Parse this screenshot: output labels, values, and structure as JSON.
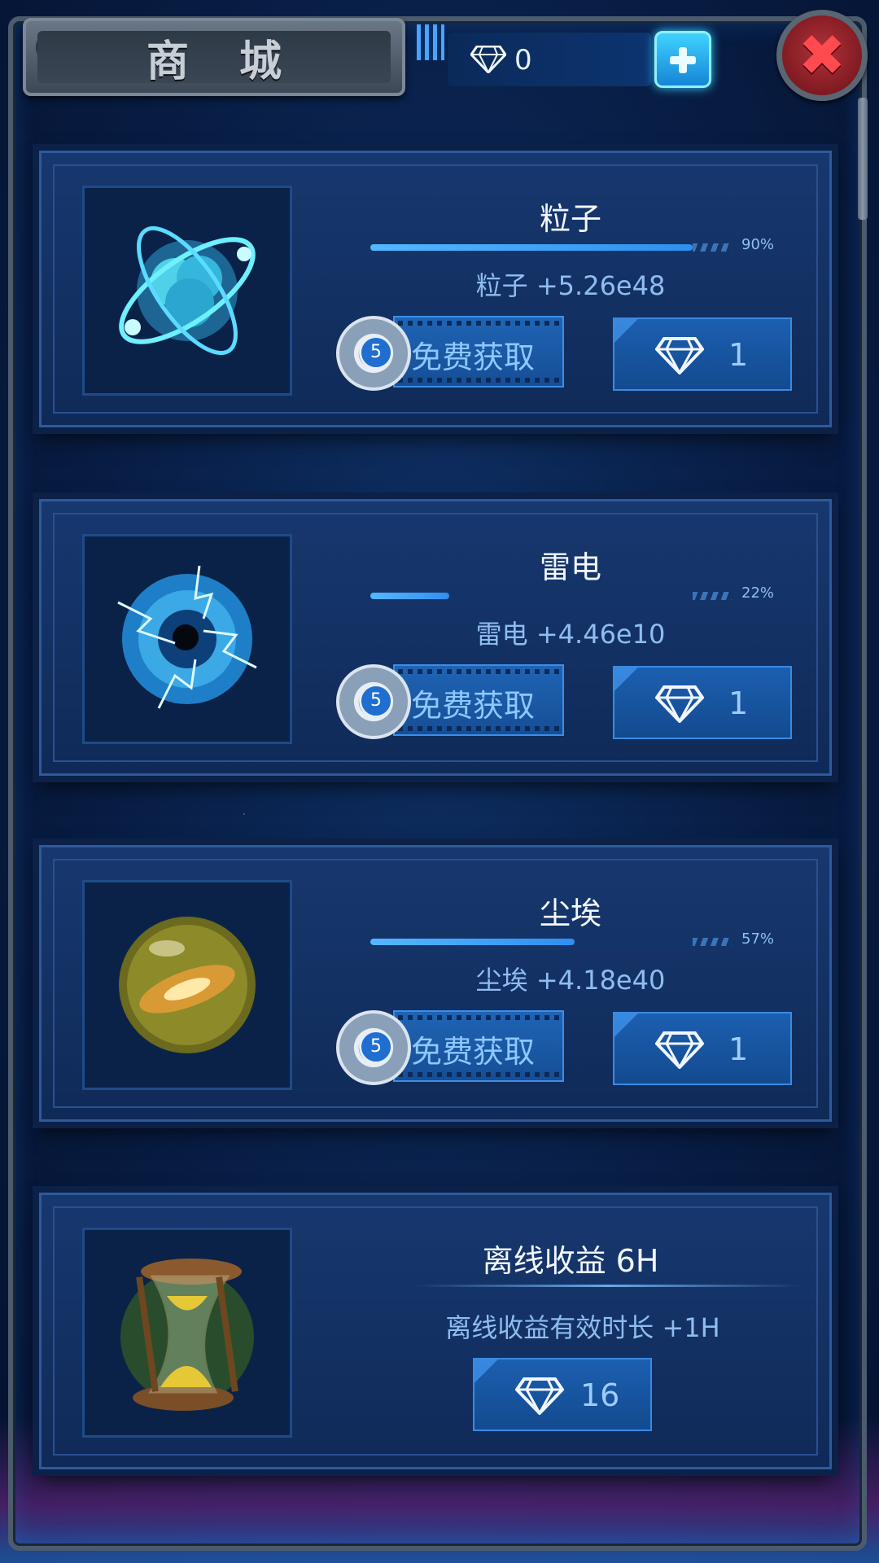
{
  "header": {
    "title": "商城",
    "gem_count": "0",
    "icons": {
      "gem": "diamond-icon",
      "add": "plus-icon",
      "close": "close-icon"
    }
  },
  "colors": {
    "accent": "#3fd3ff",
    "close": "#b1323a",
    "panel": "#17386f"
  },
  "items": [
    {
      "name": "粒子",
      "icon": "particle-atom-icon",
      "progress": 0.9,
      "percent_label": "90%",
      "bonus_name": "粒子",
      "bonus_value": "+5.26e48",
      "ad_count": "5",
      "free_label": "免费获取",
      "price": "1"
    },
    {
      "name": "雷电",
      "icon": "lightning-orb-icon",
      "progress": 0.22,
      "percent_label": "22%",
      "bonus_name": "雷电",
      "bonus_value": "+4.46e10",
      "ad_count": "5",
      "free_label": "免费获取",
      "price": "1"
    },
    {
      "name": "尘埃",
      "icon": "dust-galaxy-orb-icon",
      "progress": 0.57,
      "percent_label": "57%",
      "bonus_name": "尘埃",
      "bonus_value": "+4.18e40",
      "ad_count": "5",
      "free_label": "免费获取",
      "price": "1"
    }
  ],
  "offline": {
    "name": "离线收益 6H",
    "icon": "hourglass-icon",
    "desc_label": "离线收益有效时长",
    "desc_value": "+1H",
    "price": "16"
  }
}
